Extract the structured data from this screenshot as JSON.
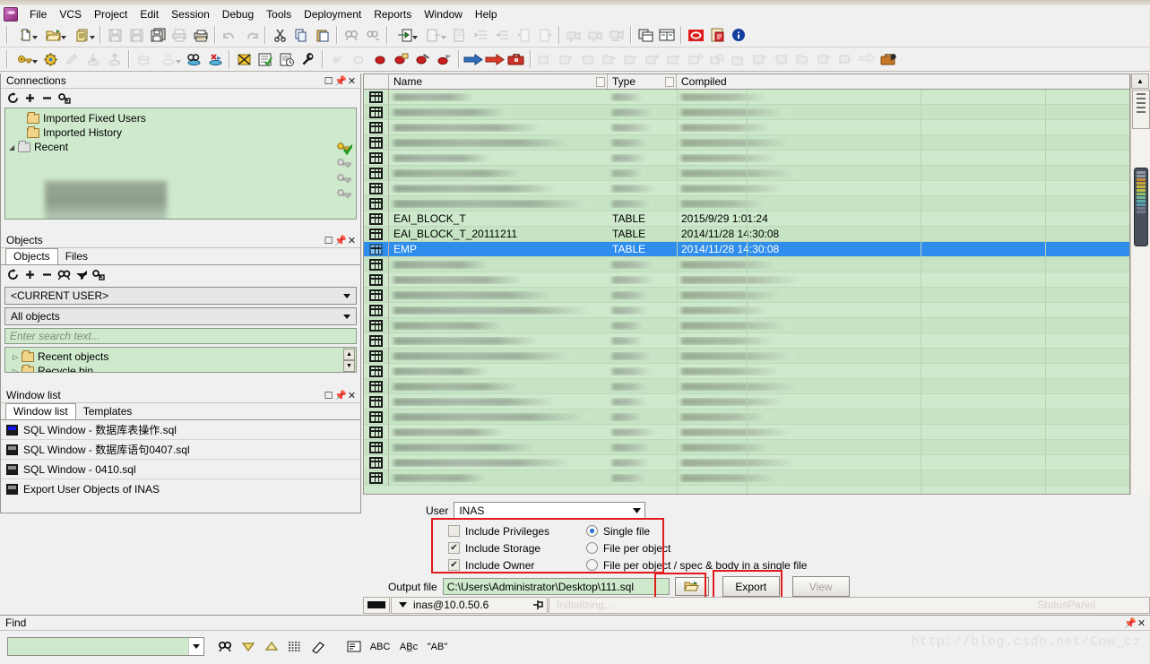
{
  "window": {
    "minimize_label": "_",
    "restore_label": "❐",
    "close_label": "✕"
  },
  "menu": {
    "logo_name": "pl-sql-developer-logo",
    "items": [
      {
        "label": "File",
        "accel": "F"
      },
      {
        "label": "VCS",
        "accel": "V"
      },
      {
        "label": "Project",
        "accel": "P"
      },
      {
        "label": "Edit",
        "accel": "E"
      },
      {
        "label": "Session",
        "accel": "S"
      },
      {
        "label": "Debug",
        "accel": "D"
      },
      {
        "label": "Tools",
        "accel": "T"
      },
      {
        "label": "Deployment",
        "accel": "y"
      },
      {
        "label": "Reports",
        "accel": "R"
      },
      {
        "label": "Window",
        "accel": "W"
      },
      {
        "label": "Help",
        "accel": "H"
      }
    ]
  },
  "connections_panel": {
    "title": "Connections",
    "tools": [
      "refresh-icon",
      "add-icon",
      "remove-icon",
      "edit-connection-icon"
    ],
    "tree": [
      {
        "label": "Imported Fixed Users",
        "icon": "folder-icon",
        "expander": ""
      },
      {
        "label": "Imported History",
        "icon": "folder-icon",
        "expander": ""
      },
      {
        "label": "Recent",
        "icon": "folder-grey-icon",
        "expander": "◢"
      }
    ]
  },
  "objects_panel": {
    "title": "Objects",
    "tabs": [
      {
        "label": "Objects",
        "active": true
      },
      {
        "label": "Files",
        "active": false
      }
    ],
    "tools": [
      "refresh-icon",
      "add-icon",
      "remove-icon",
      "find-icon",
      "filter-icon",
      "properties-icon"
    ],
    "user_select": "<CURRENT USER>",
    "filter_select": "All objects",
    "search_placeholder": "Enter search text...",
    "tree": [
      {
        "label": "Recent objects",
        "expander": "▷"
      },
      {
        "label": "Recycle bin",
        "expander": "▷"
      }
    ]
  },
  "window_list_panel": {
    "title": "Window list",
    "tabs": [
      {
        "label": "Window list",
        "active": true
      },
      {
        "label": "Templates",
        "active": false
      }
    ],
    "items": [
      {
        "label": "SQL Window - 数据库表操作.sql",
        "icon": "sql-window-icon",
        "active": true
      },
      {
        "label": "SQL Window - 数据库语句0407.sql",
        "icon": "sql-window-icon",
        "active": false
      },
      {
        "label": "SQL Window - 0410.sql",
        "icon": "sql-window-icon",
        "active": false
      },
      {
        "label": "Export User Objects of INAS",
        "icon": "export-window-icon",
        "active": false
      }
    ]
  },
  "object_grid": {
    "columns": [
      "Name",
      "Type",
      "Compiled"
    ],
    "rows": [
      {
        "name": "",
        "type": "",
        "compiled": "",
        "blurred": true
      },
      {
        "name": "",
        "type": "",
        "compiled": "",
        "blurred": true
      },
      {
        "name": "",
        "type": "",
        "compiled": "",
        "blurred": true
      },
      {
        "name": "",
        "type": "",
        "compiled": "",
        "blurred": true
      },
      {
        "name": "",
        "type": "",
        "compiled": "",
        "blurred": true
      },
      {
        "name": "",
        "type": "",
        "compiled": "",
        "blurred": true
      },
      {
        "name": "",
        "type": "",
        "compiled": "",
        "blurred": true
      },
      {
        "name": "",
        "type": "",
        "compiled": "",
        "blurred": true
      },
      {
        "name": "EAI_BLOCK_T",
        "type": "TABLE",
        "compiled": "2015/9/29 1:01:24",
        "blurred": false
      },
      {
        "name": "EAI_BLOCK_T_20111211",
        "type": "TABLE",
        "compiled": "2014/11/28 14:30:08",
        "blurred": false
      },
      {
        "name": "EMP",
        "type": "TABLE",
        "compiled": "2014/11/28 14:30:08",
        "blurred": false,
        "selected": true
      },
      {
        "name": "",
        "type": "",
        "compiled": "",
        "blurred": true
      },
      {
        "name": "",
        "type": "",
        "compiled": "",
        "blurred": true
      },
      {
        "name": "",
        "type": "",
        "compiled": "",
        "blurred": true
      },
      {
        "name": "",
        "type": "",
        "compiled": "",
        "blurred": true
      },
      {
        "name": "",
        "type": "",
        "compiled": "",
        "blurred": true
      },
      {
        "name": "",
        "type": "",
        "compiled": "",
        "blurred": true
      },
      {
        "name": "",
        "type": "",
        "compiled": "",
        "blurred": true
      },
      {
        "name": "",
        "type": "",
        "compiled": "",
        "blurred": true
      },
      {
        "name": "",
        "type": "",
        "compiled": "",
        "blurred": true
      },
      {
        "name": "",
        "type": "",
        "compiled": "",
        "blurred": true
      },
      {
        "name": "",
        "type": "",
        "compiled": "",
        "blurred": true
      },
      {
        "name": "",
        "type": "",
        "compiled": "",
        "blurred": true
      },
      {
        "name": "",
        "type": "",
        "compiled": "",
        "blurred": true
      },
      {
        "name": "",
        "type": "",
        "compiled": "",
        "blurred": true
      },
      {
        "name": "",
        "type": "",
        "compiled": "",
        "blurred": true
      }
    ]
  },
  "export_panel": {
    "user_label": "User",
    "user_value": "INAS",
    "checkboxes": [
      {
        "label": "Include Privileges",
        "checked": false,
        "enabled": false
      },
      {
        "label": "Include Storage",
        "checked": true,
        "enabled": true
      },
      {
        "label": "Include Owner",
        "checked": true,
        "enabled": true
      }
    ],
    "radios": [
      {
        "label": "Single file",
        "selected": true
      },
      {
        "label": "File per object",
        "selected": false
      },
      {
        "label": "File per object / spec & body in a single file",
        "selected": false
      }
    ],
    "output_label": "Output file",
    "output_value": "C:\\Users\\Administrator\\Desktop\\111.sql",
    "browse_icon": "open-folder-icon",
    "export_button": "Export",
    "view_button": "View",
    "highlight_color": "#e01b1b"
  },
  "statusbar": {
    "connection": "inas@10.0.50.6",
    "message": "Initializing...",
    "panel_label": "StatusPanel",
    "pin_icon": "pin-icon"
  },
  "find_panel": {
    "title": "Find",
    "input_value": "",
    "buttons": [
      "find-icon",
      "find-next-icon",
      "find-previous-icon",
      "highlight-all-icon",
      "clear-highlight-icon",
      "options-icon"
    ],
    "toggles": [
      "ABC",
      "AB̲c",
      "\"AB\""
    ]
  },
  "watermark": "http://blog.csdn.net/Cow_cz",
  "colors": {
    "panel_bg": "#f0f0f0",
    "grid_bg": "#cfe9cd",
    "selection": "#2e8ded",
    "highlight": "#e01b1b"
  }
}
